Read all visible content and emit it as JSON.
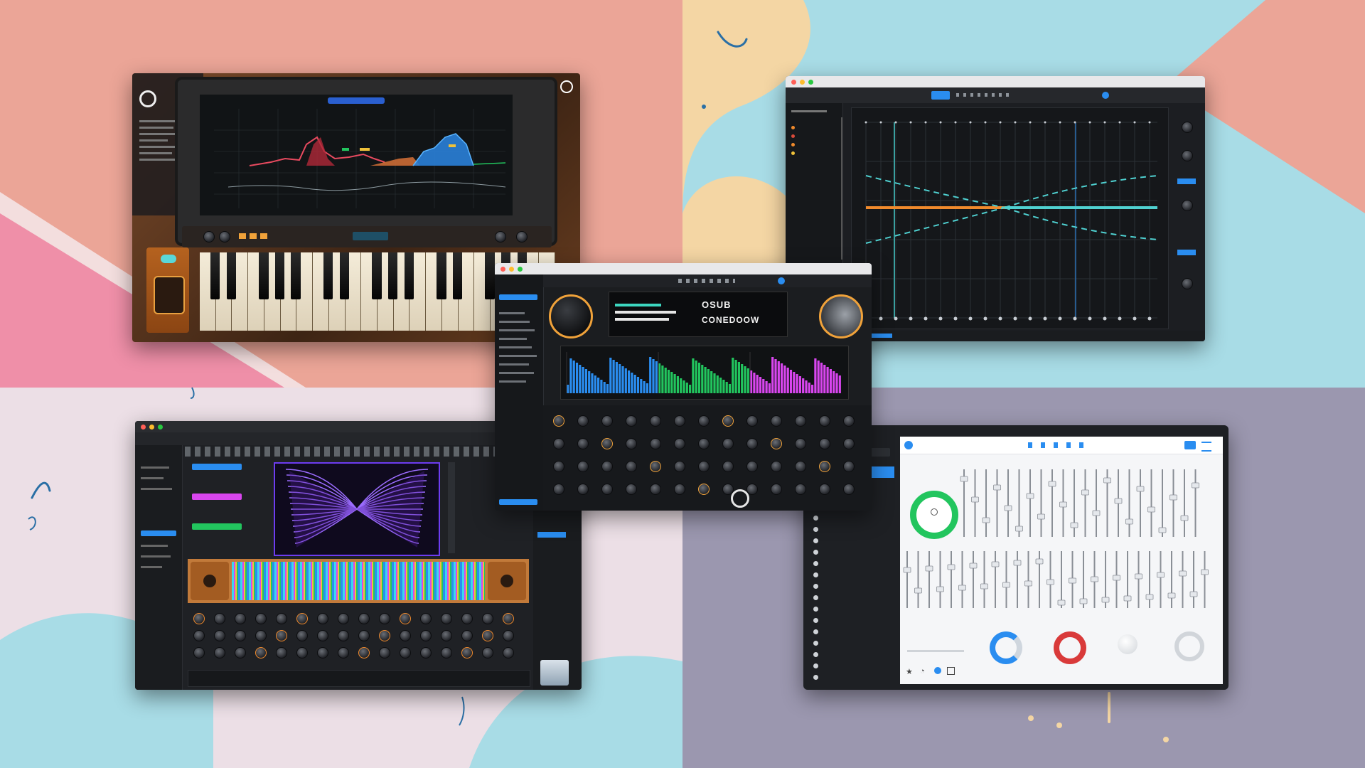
{
  "colors": {
    "bg_salmon": "#eba597",
    "bg_sky": "#a8dce6",
    "bg_lilac": "#ecdfe6",
    "bg_slate": "#9b97af",
    "accent_blue": "#2a8df0",
    "accent_green": "#22c55e",
    "accent_magenta": "#d946ef",
    "accent_orange": "#f08a2c"
  },
  "synth": {
    "logo_text": "",
    "screen_title": "",
    "icon": "chat-icon"
  },
  "eq": {
    "window_title": "",
    "logo": "",
    "toolbar_tag": "",
    "brand_badge": ""
  },
  "center": {
    "window_title": "",
    "brand_left": "",
    "brand_right": "",
    "display_line1": "OSUB",
    "display_line2": "CONEDOOW",
    "sidebar_items": [
      "",
      "",
      "",
      "",
      "",
      "",
      "",
      "",
      ""
    ],
    "icon": "play-icon"
  },
  "visual": {
    "window_title": "",
    "brand_left": "",
    "brand_right": "",
    "list_items": [
      "",
      "",
      "",
      "",
      "",
      "",
      ""
    ],
    "icon": "play-icon"
  },
  "mixer": {
    "window_title": "",
    "app_title": "",
    "sidebar_header": "",
    "sidebar_items": [
      "",
      "",
      "",
      "",
      "",
      "",
      "",
      "",
      "",
      "",
      "",
      "",
      "",
      "",
      "",
      "",
      "",
      "",
      ""
    ],
    "icons": [
      "star-icon",
      "bell-icon",
      "share-icon",
      "grid-icon"
    ]
  }
}
